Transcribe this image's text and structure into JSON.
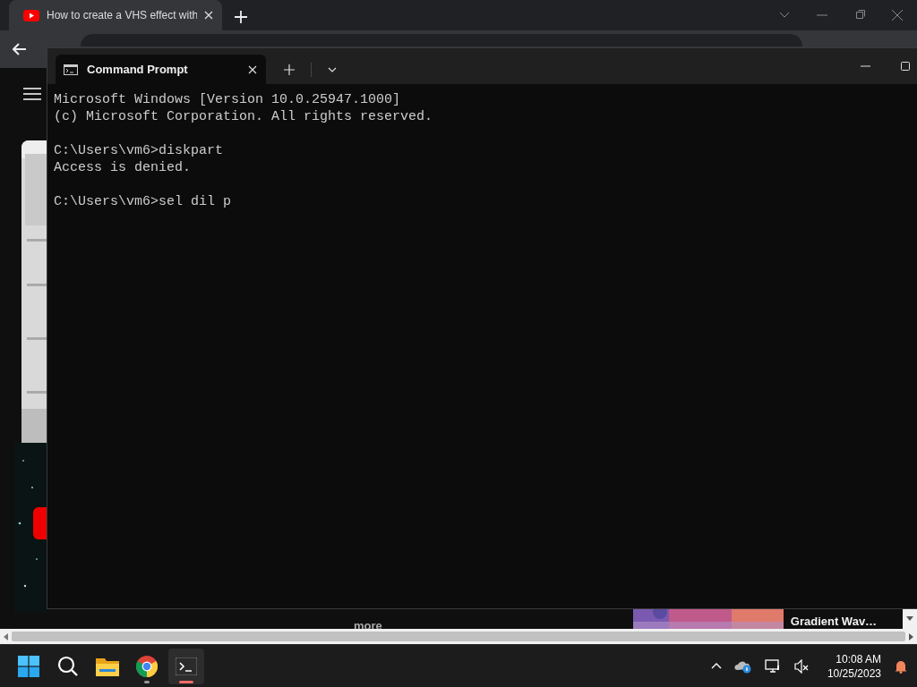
{
  "browser": {
    "tabs": [
      {
        "title": "How to create a VHS effect with",
        "selected": true
      }
    ],
    "more_link": "more",
    "video_title": "Gradient Wav…"
  },
  "terminal": {
    "tabs": [
      {
        "title": "Command Prompt",
        "selected": true
      }
    ],
    "blocks": [
      [
        "Microsoft Windows [Version 10.0.25947.1000]",
        "(c) Microsoft Corporation. All rights reserved."
      ],
      [
        "C:\\Users\\vm6>diskpart",
        "Access is denied."
      ],
      [
        "C:\\Users\\vm6>sel dil p"
      ]
    ]
  },
  "taskbar": {
    "apps": [
      {
        "kind": "start",
        "running": false,
        "active": false
      },
      {
        "kind": "search",
        "running": false,
        "active": false
      },
      {
        "kind": "files",
        "running": false,
        "active": false
      },
      {
        "kind": "chrome",
        "running": true,
        "active": false
      },
      {
        "kind": "terminal",
        "running": true,
        "active": true
      }
    ],
    "time": "10:08 AM",
    "date": "10/25/2023"
  }
}
